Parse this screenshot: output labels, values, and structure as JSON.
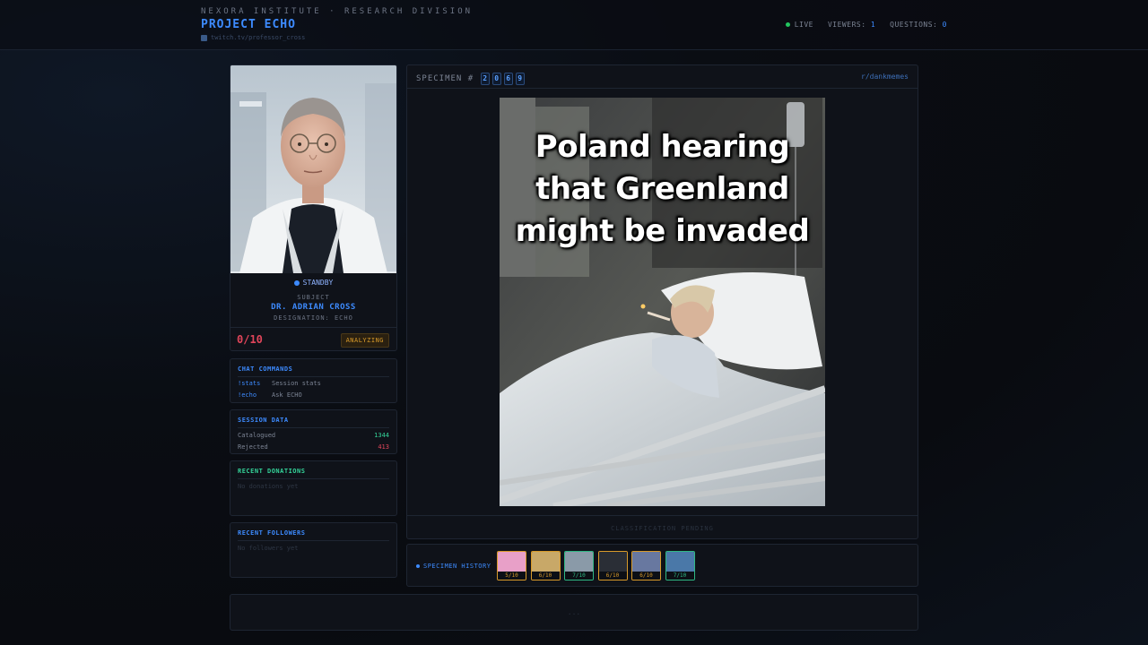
{
  "header": {
    "org": "NEXORA INSTITUTE · RESEARCH DIVISION",
    "title": "PROJECT ECHO",
    "channel": "twitch.tv/professor_cross",
    "live_label": "LIVE",
    "viewers_label": "VIEWERS:",
    "viewers_value": "1",
    "questions_label": "QUESTIONS:",
    "questions_value": "0"
  },
  "subject": {
    "status": "STANDBY",
    "label": "SUBJECT",
    "name": "DR. ADRIAN CROSS",
    "designation": "DESIGNATION: ECHO",
    "score": "0/10",
    "score_state": "ANALYZING"
  },
  "chat_commands": {
    "title": "CHAT COMMANDS",
    "items": [
      {
        "cmd": "!stats",
        "desc": "Session stats"
      },
      {
        "cmd": "!echo",
        "desc": "Ask ECHO"
      }
    ]
  },
  "session_data": {
    "title": "SESSION DATA",
    "catalogued_label": "Catalogued",
    "catalogued_value": "1344",
    "rejected_label": "Rejected",
    "rejected_value": "413"
  },
  "donations": {
    "title": "RECENT DONATIONS",
    "empty": "No donations yet"
  },
  "followers": {
    "title": "RECENT FOLLOWERS",
    "empty": "No followers yet"
  },
  "specimen": {
    "label": "SPECIMEN #",
    "digits": [
      "2",
      "0",
      "6",
      "9"
    ],
    "source": "r/dankmemes",
    "caption": "Poland hearing that Greenland might be invaded",
    "classification": "CLASSIFICATION PENDING"
  },
  "history": {
    "label": "SPECIMEN HISTORY",
    "items": [
      {
        "score": "5/10",
        "tier": "amber",
        "color": "#e8a0c8"
      },
      {
        "score": "6/10",
        "tier": "amber",
        "color": "#c8a868"
      },
      {
        "score": "7/10",
        "tier": "green",
        "color": "#8a9aa8"
      },
      {
        "score": "6/10",
        "tier": "amber",
        "color": "#2a2e36"
      },
      {
        "score": "6/10",
        "tier": "amber",
        "color": "#6878a0"
      },
      {
        "score": "7/10",
        "tier": "green",
        "color": "#4a78a8"
      }
    ]
  },
  "footer": {
    "text": "..."
  },
  "colors": {
    "accent": "#3d8bff",
    "live": "#22c55e",
    "danger": "#e0455a",
    "amber": "#d89a2a",
    "green": "#2fb884"
  }
}
